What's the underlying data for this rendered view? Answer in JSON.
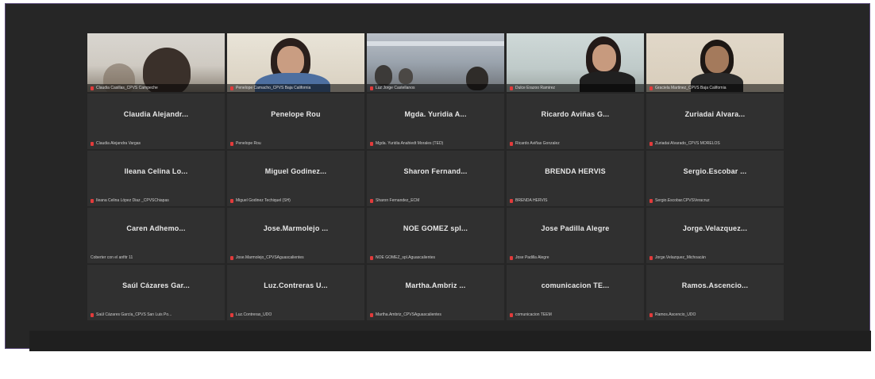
{
  "meeting": {
    "video_tiles": [
      {
        "label": "Claudia Casillas_CPVS Campeche"
      },
      {
        "label": "Penelope Camacho_CPVS Baja California"
      },
      {
        "label": "Luz Jorge Castellanos"
      },
      {
        "label": "Dulce Erazoo Ramirez"
      },
      {
        "label": "Graciela Martinez_CPVS Baja California"
      }
    ],
    "participants": [
      {
        "name": "Claudia Alejandr...",
        "label": "Claudia Alejandra Vargas"
      },
      {
        "name": "Penelope Rou",
        "label": "Penelope Rou"
      },
      {
        "name": "Mgda. Yuridia A...",
        "label": "Mgda. Yuridia Anahiedt Morales (TED)"
      },
      {
        "name": "Ricardo Aviñas G...",
        "label": "Ricardo Aviñas Gonzalez"
      },
      {
        "name": "Zuriadai Alvara...",
        "label": "Zuriadai Alvarado_CPVS MORELOS"
      },
      {
        "name": "Ileana Celina Lo...",
        "label": "Ileana Celina López Diaz _CPVSChiapas"
      },
      {
        "name": "Miguel Godinez...",
        "label": "Miguel Godinez Techiquel (SH)"
      },
      {
        "name": "Sharon Fernand...",
        "label": "Sharon Fernandez_ECM"
      },
      {
        "name": "BRENDA HERVIS",
        "label": "BRENDA HERVIS"
      },
      {
        "name": "Sergio.Escobar ...",
        "label": "Sergio.Escobar.CPVSVeracruz"
      },
      {
        "name": "Caren Adhemo...",
        "label": "Coberter con el anfitr 11"
      },
      {
        "name": "Jose.Marmolejo ...",
        "label": "Jose.Marmolejo_CPVSAguascalientes"
      },
      {
        "name": "NOE GOMEZ spl...",
        "label": "NOE GOMEZ_spl.Aguascalientes"
      },
      {
        "name": "Jose Padilla Alegre",
        "label": "Jose Padilla Alegre"
      },
      {
        "name": "Jorge.Velazquez...",
        "label": "Jorge.Velazquez_Michoacán"
      },
      {
        "name": "Saúl Cázares Gar...",
        "label": "Saúl Cázares García_CPVS San Luis Po..."
      },
      {
        "name": "Luz.Contreras U...",
        "label": "Luz.Contreras_UDO"
      },
      {
        "name": "Martha.Ambriz ...",
        "label": "Martha.Ambriz_CPVSAguascalientes"
      },
      {
        "name": "comunicacion TE...",
        "label": "comunicacion TEEM"
      },
      {
        "name": "Ramos.Ascencio...",
        "label": "Ramos.Ascencio_UDO"
      }
    ]
  },
  "colors": {
    "background": "#262626",
    "tile": "#303030",
    "active_speaker_border": "#c8d36a",
    "muted_icon": "#e23b3b"
  }
}
